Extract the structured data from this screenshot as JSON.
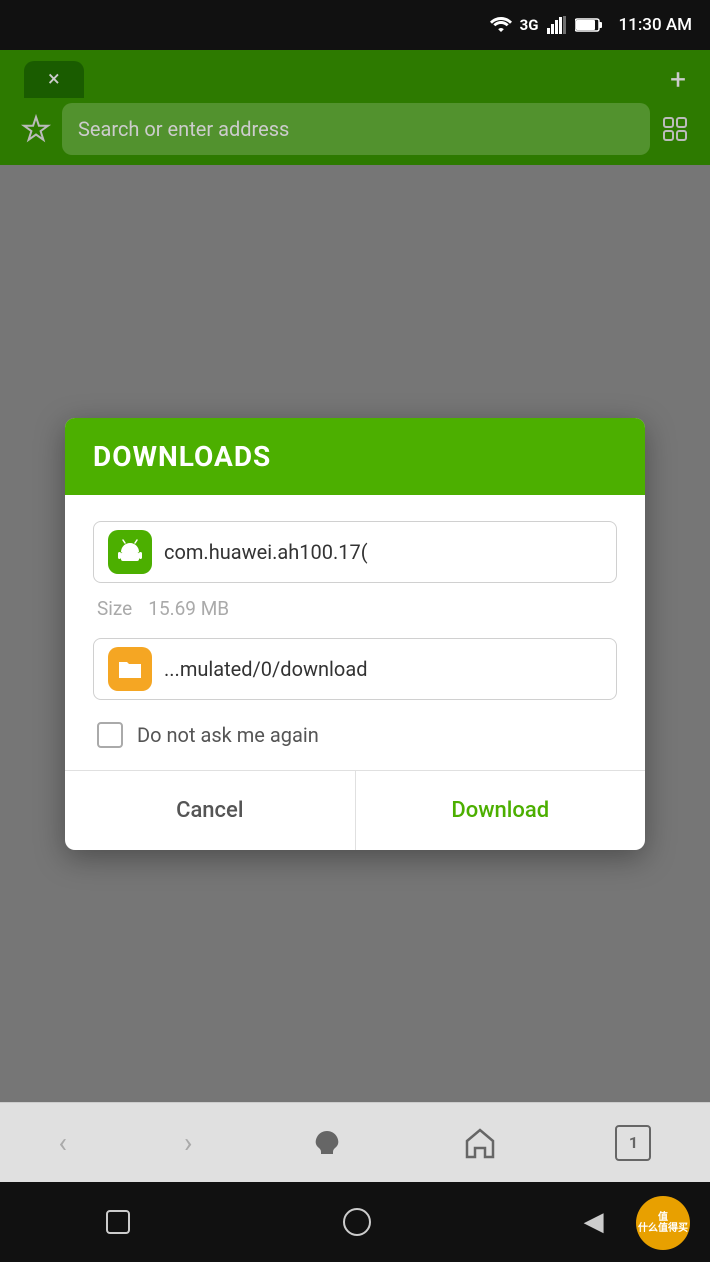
{
  "statusBar": {
    "time": "11:30 AM",
    "network": "3G"
  },
  "toolbar": {
    "tabCloseLabel": "×",
    "addTabLabel": "+",
    "searchPlaceholder": "Search or enter address"
  },
  "bottomNav": {
    "back": "‹",
    "forward": "›",
    "refresh": "↻",
    "home": "⌂",
    "tabs": "1"
  },
  "dialog": {
    "title": "DOWNLOADS",
    "fileName": "com.huawei.ah100.17(",
    "sizeLabel": "Size",
    "sizeValue": "15.69 MB",
    "folderPath": "...mulated/0/download",
    "checkboxLabel": "Do not ask me again",
    "cancelLabel": "Cancel",
    "downloadLabel": "Download"
  },
  "watermark": {
    "text": "值 什么值得买"
  }
}
